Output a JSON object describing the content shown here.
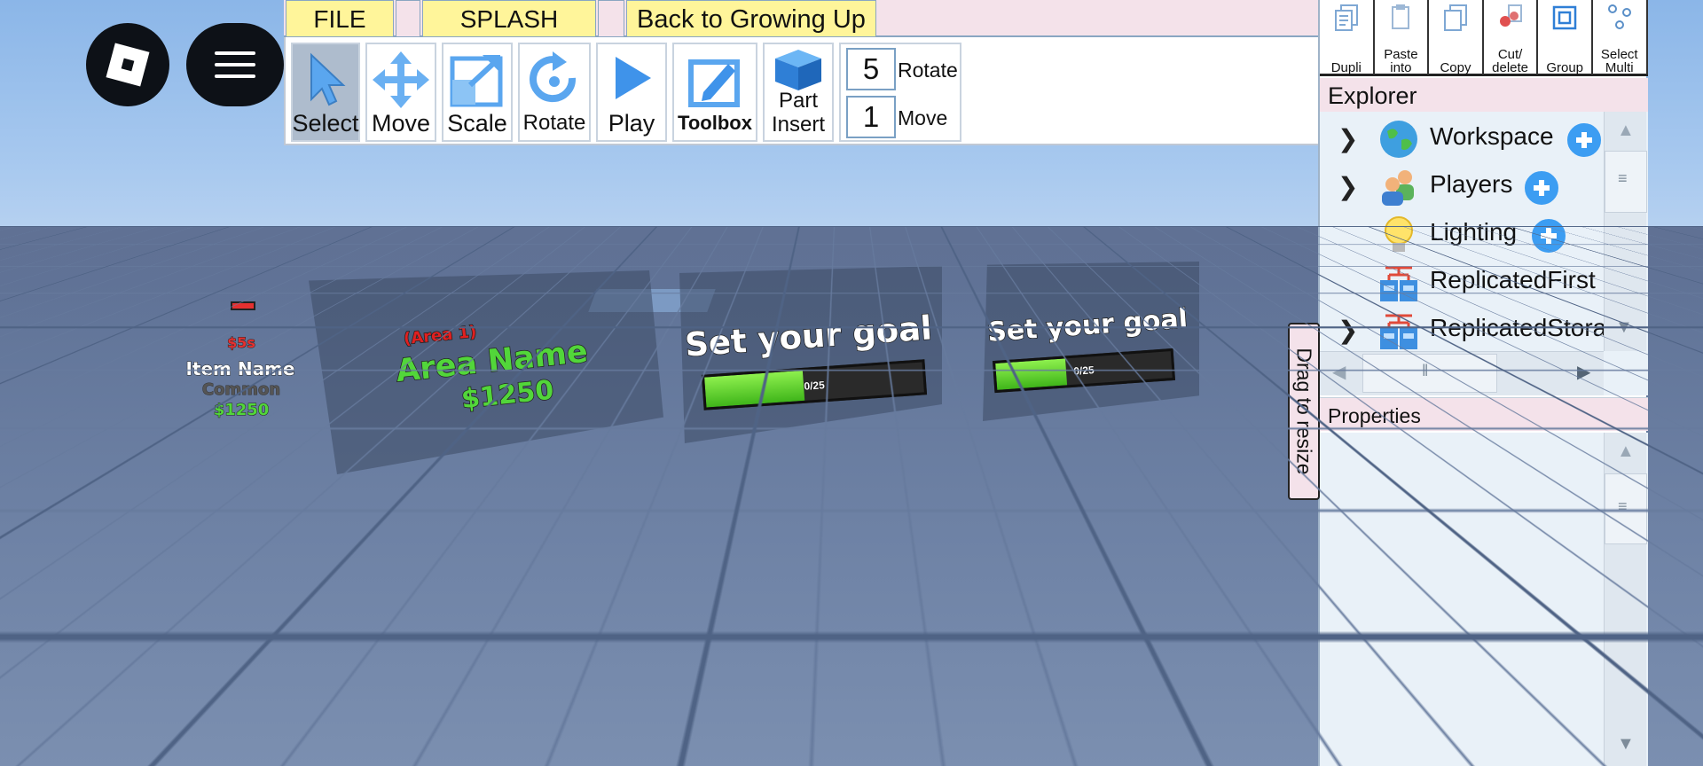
{
  "menu_tabs": {
    "file": "FILE",
    "splash": "SPLASH",
    "back": "Back to Growing Up"
  },
  "toolbar": {
    "select": "Select",
    "move": "Move",
    "scale": "Scale",
    "rotate": "Rotate",
    "play": "Play",
    "toolbox": "Toolbox",
    "part_insert_1": "Part",
    "part_insert_2": "Insert",
    "rotate_step_value": "5",
    "rotate_step_label": "Rotate",
    "move_step_value": "1",
    "move_step_label": "Move",
    "active_tool": "select"
  },
  "actions": [
    {
      "label": "Dupli",
      "icon": "duplicate-icon"
    },
    {
      "label": "Paste into",
      "icon": "paste-icon"
    },
    {
      "label": "Copy",
      "icon": "copy-icon"
    },
    {
      "label": "Cut/ delete",
      "icon": "cut-icon"
    },
    {
      "label": "Group",
      "icon": "group-icon"
    },
    {
      "label": "Select Multi",
      "icon": "select-multi-icon"
    }
  ],
  "explorer": {
    "title": "Explorer",
    "items": [
      {
        "name": "Workspace",
        "icon": "globe-icon",
        "expandable": true,
        "addable": true
      },
      {
        "name": "Players",
        "icon": "players-icon",
        "expandable": true,
        "addable": true
      },
      {
        "name": "Lighting",
        "icon": "lightbulb-icon",
        "expandable": false,
        "addable": true
      },
      {
        "name": "ReplicatedFirst",
        "icon": "replicated-icon",
        "expandable": false,
        "addable": false
      },
      {
        "name": "ReplicatedStorage",
        "icon": "replicated-icon",
        "expandable": true,
        "addable": false
      }
    ]
  },
  "properties": {
    "title": "Properties"
  },
  "drag_resize": "Drag to resize",
  "scene": {
    "item": {
      "rate": "$5s",
      "name": "Item Name",
      "rarity": "Common",
      "price": "$1250"
    },
    "area": {
      "tag": "(Area 1)",
      "name": "Area Name",
      "price": "$1250"
    },
    "goal_1": {
      "label": "Set your goal",
      "progress_text": "0/25",
      "progress": 0.45
    },
    "goal_2": {
      "label": "Set your goal",
      "progress_text": "0/25",
      "progress": 0.4
    }
  },
  "colors": {
    "tab_yellow": "#fff59a",
    "panel_pink": "#f4e2ea",
    "accent_blue": "#3c9df2",
    "game_green": "#52d63a",
    "game_red": "#e02020"
  }
}
